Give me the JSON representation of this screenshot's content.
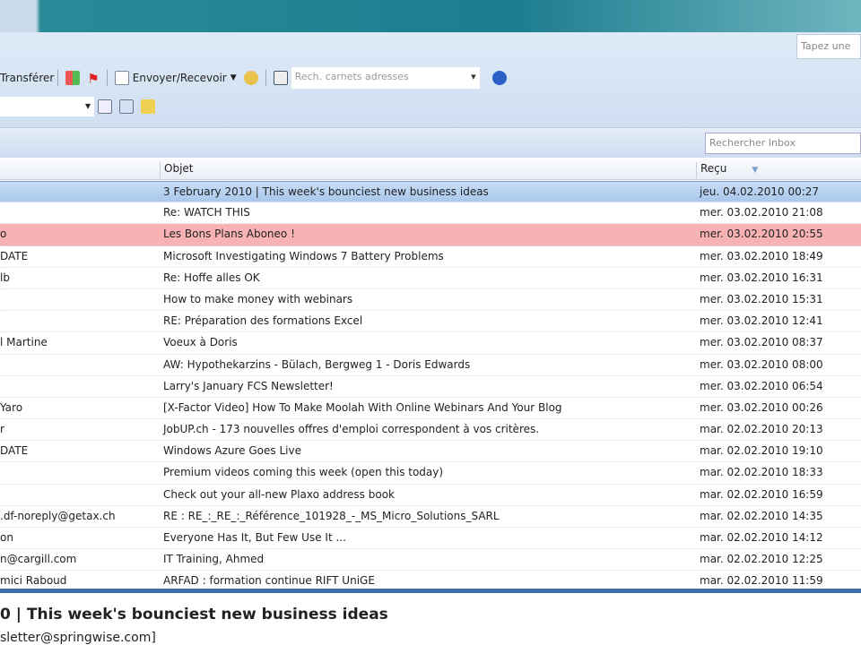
{
  "header": {
    "help_search": "Tapez une"
  },
  "toolbar": {
    "forward": "Transférer",
    "send_receive": "Envoyer/Recevoir",
    "address_search": "Rech. carnets adresses"
  },
  "search": {
    "placeholder": "Rechercher Inbox"
  },
  "columns": {
    "subject": "Objet",
    "received": "Reçu"
  },
  "messages": [
    {
      "from": "",
      "subject": "3 February 2010 | This week's bounciest new business ideas",
      "received": "jeu. 04.02.2010 00:27"
    },
    {
      "from": "",
      "subject": "Re: WATCH THIS",
      "received": "mer. 03.02.2010 21:08"
    },
    {
      "from": "o",
      "subject": "Les Bons Plans Aboneo !",
      "received": "mer. 03.02.2010 20:55"
    },
    {
      "from": "DATE",
      "subject": "Microsoft Investigating Windows 7 Battery Problems",
      "received": "mer. 03.02.2010 18:49"
    },
    {
      "from": "lb",
      "subject": "Re: Hoffe alles OK",
      "received": "mer. 03.02.2010 16:31"
    },
    {
      "from": "",
      "subject": "How to make money with webinars",
      "received": "mer. 03.02.2010 15:31"
    },
    {
      "from": "",
      "subject": "RE: Préparation des formations Excel",
      "received": "mer. 03.02.2010 12:41"
    },
    {
      "from": "l Martine",
      "subject": "Voeux à Doris",
      "received": "mer. 03.02.2010 08:37"
    },
    {
      "from": "",
      "subject": "AW: Hypothekarzins - Bülach, Bergweg 1 - Doris Edwards",
      "received": "mer. 03.02.2010 08:00"
    },
    {
      "from": "",
      "subject": "Larry's January FCS Newsletter!",
      "received": "mer. 03.02.2010 06:54"
    },
    {
      "from": "Yaro",
      "subject": "[X-Factor Video] How To Make Moolah With Online Webinars And Your Blog",
      "received": "mer. 03.02.2010 00:26"
    },
    {
      "from": "r",
      "subject": "JobUP.ch - 173 nouvelles offres d'emploi correspondent à vos critères.",
      "received": "mar. 02.02.2010 20:13"
    },
    {
      "from": "DATE",
      "subject": "Windows Azure Goes Live",
      "received": "mar. 02.02.2010 19:10"
    },
    {
      "from": "",
      "subject": "Premium videos coming this week (open this today)",
      "received": "mar. 02.02.2010 18:33"
    },
    {
      "from": "",
      "subject": "Check out your all-new Plaxo address book",
      "received": "mar. 02.02.2010 16:59"
    },
    {
      "from": ".df-noreply@getax.ch",
      "subject": "RE : RE_:_RE_:_Référence_101928_-_MS_Micro_Solutions_SARL",
      "received": "mar. 02.02.2010 14:35"
    },
    {
      "from": "on",
      "subject": "Everyone Has It, But Few Use It ...",
      "received": "mar. 02.02.2010 14:12"
    },
    {
      "from": "n@cargill.com",
      "subject": "IT Training, Ahmed",
      "received": "mar. 02.02.2010 12:25"
    },
    {
      "from": "mici Raboud",
      "subject": "ARFAD : formation continue RIFT UniGE",
      "received": "mar. 02.02.2010 11:59"
    }
  ],
  "preview": {
    "subject": "0 | This week's bounciest new business ideas",
    "from": "sletter@springwise.com]"
  }
}
